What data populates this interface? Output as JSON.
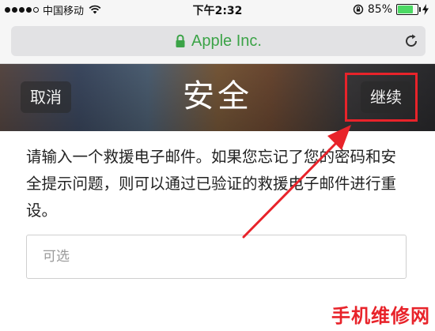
{
  "status_bar": {
    "signal_dots_filled": 4,
    "signal_dots_total": 5,
    "carrier": "中国移动",
    "wifi_icon": "wifi-icon",
    "time": "下午2:32",
    "rotation_lock_icon": "rotation-lock-icon",
    "battery_percent": "85%",
    "battery_level": 0.85,
    "battery_color": "#4cd964"
  },
  "url_bar": {
    "lock_icon": "lock-icon",
    "site_name": "Apple Inc.",
    "site_color": "#3ba347",
    "reload_icon": "reload-icon"
  },
  "nav": {
    "cancel_label": "取消",
    "title": "安全",
    "continue_label": "继续"
  },
  "content": {
    "description": "请输入一个救援电子邮件。如果您忘记了您的密码和安全提示问题，则可以通过已验证的救援电子邮件进行重设。",
    "rescue_email_placeholder": "可选",
    "rescue_email_value": ""
  },
  "annotation": {
    "highlight_color": "#e8232a"
  },
  "watermark": {
    "text": "手机维修网"
  }
}
